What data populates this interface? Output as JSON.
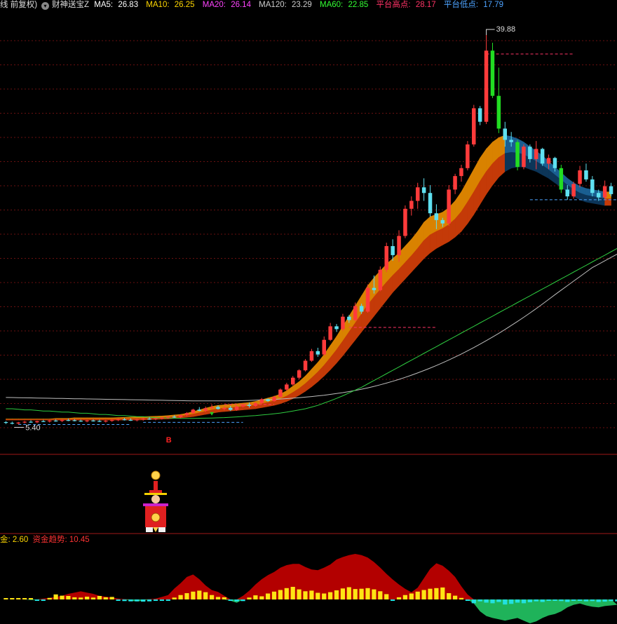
{
  "header": {
    "period_mode": "线 前复权)",
    "indicator_name": "财神送宝Z",
    "dropdown_icon": "chevron-down-icon",
    "ma5_label": "MA5:",
    "ma5_value": "26.83",
    "ma10_label": "MA10:",
    "ma10_value": "26.25",
    "ma20_label": "MA20:",
    "ma20_value": "26.14",
    "ma120_label": "MA120:",
    "ma120_value": "23.29",
    "ma60_label": "MA60:",
    "ma60_value": "22.85",
    "platform_high_label": "平台高点:",
    "platform_high_value": "28.17",
    "platform_low_label": "平台低点:",
    "platform_low_value": "17.79",
    "colors": {
      "ma5": "#ffffff",
      "ma10": "#ffd700",
      "ma20": "#ff44ff",
      "ma120": "#cccccc",
      "ma60": "#33ff33",
      "platform_high": "#ff3366",
      "platform_low": "#4da3ff"
    }
  },
  "sub_header": {
    "fund_label": "金:",
    "fund_value": "2.60",
    "trend_label": "资金趋势:",
    "trend_value": "10.45",
    "colors": {
      "fund": "#ffd700",
      "trend": "#ff3333"
    }
  },
  "chart_data": {
    "type": "candlestick",
    "y_range": [
      5.0,
      40.5
    ],
    "annotations": {
      "max_price": "39.88",
      "min_price": "5.40",
      "buy_marker": "B"
    },
    "candles": [
      [
        5.62,
        5.7,
        5.45,
        5.55
      ],
      [
        5.55,
        5.66,
        5.42,
        5.5
      ],
      [
        5.5,
        5.64,
        5.4,
        5.58
      ],
      [
        5.58,
        5.72,
        5.5,
        5.65
      ],
      [
        5.65,
        5.78,
        5.55,
        5.6
      ],
      [
        5.6,
        5.74,
        5.52,
        5.7
      ],
      [
        5.7,
        5.82,
        5.62,
        5.68
      ],
      [
        5.68,
        5.8,
        5.58,
        5.75
      ],
      [
        5.75,
        5.86,
        5.65,
        5.72
      ],
      [
        5.72,
        5.84,
        5.62,
        5.8
      ],
      [
        5.8,
        5.92,
        5.7,
        5.78
      ],
      [
        5.78,
        5.88,
        5.68,
        5.74
      ],
      [
        5.74,
        5.84,
        5.64,
        5.7
      ],
      [
        5.7,
        5.82,
        5.6,
        5.76
      ],
      [
        5.76,
        5.86,
        5.66,
        5.72
      ],
      [
        5.72,
        5.84,
        5.62,
        5.68
      ],
      [
        5.68,
        5.8,
        5.58,
        5.74
      ],
      [
        5.74,
        5.86,
        5.64,
        5.8
      ],
      [
        5.8,
        5.92,
        5.7,
        5.86
      ],
      [
        5.86,
        5.98,
        5.76,
        5.82
      ],
      [
        5.82,
        5.94,
        5.72,
        5.78
      ],
      [
        5.78,
        5.9,
        5.68,
        5.85
      ],
      [
        5.85,
        5.98,
        5.75,
        5.92
      ],
      [
        5.92,
        6.05,
        5.82,
        5.88
      ],
      [
        5.88,
        6.0,
        5.78,
        5.95
      ],
      [
        5.95,
        6.08,
        5.85,
        6.02
      ],
      [
        6.02,
        6.15,
        5.92,
        6.1
      ],
      [
        6.1,
        6.22,
        6.0,
        6.06
      ],
      [
        6.06,
        6.2,
        5.96,
        6.25
      ],
      [
        6.25,
        6.5,
        6.15,
        6.42
      ],
      [
        6.42,
        6.8,
        6.36,
        6.72
      ],
      [
        6.72,
        6.95,
        6.58,
        6.62
      ],
      [
        6.62,
        7.0,
        6.52,
        6.85
      ],
      [
        6.85,
        7.2,
        6.75,
        6.95
      ],
      [
        6.95,
        7.1,
        6.72,
        6.78
      ],
      [
        6.78,
        7.02,
        6.66,
        6.88
      ],
      [
        6.88,
        7.05,
        6.6,
        6.7
      ],
      [
        6.7,
        7.1,
        6.62,
        7.0
      ],
      [
        7.0,
        7.3,
        6.92,
        7.15
      ],
      [
        7.15,
        7.35,
        6.9,
        7.05
      ],
      [
        7.05,
        7.4,
        6.98,
        7.3
      ],
      [
        7.3,
        7.75,
        7.2,
        7.65
      ],
      [
        7.65,
        7.7,
        7.4,
        7.48
      ],
      [
        7.48,
        7.95,
        7.42,
        7.85
      ],
      [
        7.85,
        8.6,
        7.8,
        8.5
      ],
      [
        8.5,
        9.1,
        8.4,
        8.95
      ],
      [
        8.95,
        9.7,
        8.85,
        9.55
      ],
      [
        9.55,
        10.3,
        9.4,
        10.2
      ],
      [
        10.2,
        11.2,
        10.1,
        11.05
      ],
      [
        11.05,
        12.1,
        10.95,
        11.9
      ],
      [
        11.9,
        12.2,
        11.4,
        11.6
      ],
      [
        11.6,
        13.2,
        11.5,
        12.9
      ],
      [
        12.9,
        14.4,
        12.8,
        14.1
      ],
      [
        14.1,
        14.3,
        13.6,
        13.85
      ],
      [
        13.85,
        15.2,
        13.7,
        14.95
      ],
      [
        14.95,
        15.1,
        14.4,
        14.65
      ],
      [
        14.65,
        16.2,
        14.55,
        15.9
      ],
      [
        15.9,
        16.1,
        15.2,
        15.4
      ],
      [
        15.4,
        17.8,
        15.3,
        17.5
      ],
      [
        17.5,
        18.6,
        17.0,
        17.3
      ],
      [
        17.3,
        19.4,
        17.2,
        19.1
      ],
      [
        19.1,
        21.5,
        18.9,
        21.2
      ],
      [
        21.2,
        21.8,
        19.9,
        20.4
      ],
      [
        20.4,
        22.6,
        19.8,
        22.1
      ],
      [
        22.1,
        24.8,
        21.9,
        24.5
      ],
      [
        24.5,
        25.6,
        23.9,
        25.2
      ],
      [
        25.2,
        26.8,
        24.5,
        26.4
      ],
      [
        26.4,
        27.2,
        25.2,
        25.9
      ],
      [
        25.9,
        26.6,
        23.8,
        24.1
      ],
      [
        24.1,
        24.9,
        22.7,
        23.5
      ],
      [
        23.5,
        23.7,
        22.9,
        23.2
      ],
      [
        23.2,
        26.6,
        23.0,
        26.2
      ],
      [
        26.2,
        27.6,
        25.8,
        27.4
      ],
      [
        27.4,
        28.4,
        26.9,
        28.1
      ],
      [
        28.1,
        30.5,
        27.9,
        30.2
      ],
      [
        30.2,
        33.7,
        30.0,
        33.4
      ],
      [
        33.4,
        33.6,
        31.9,
        32.2
      ],
      [
        32.2,
        39.88,
        32.0,
        38.5
      ],
      [
        38.5,
        39.2,
        34.3,
        34.5
      ],
      [
        34.5,
        37.0,
        31.2,
        31.6
      ],
      [
        31.6,
        32.2,
        30.0,
        30.6
      ],
      [
        30.6,
        31.3,
        30.0,
        30.4
      ],
      [
        30.4,
        30.6,
        27.9,
        28.2
      ],
      [
        28.2,
        30.2,
        28.0,
        30.0
      ],
      [
        30.0,
        30.2,
        28.6,
        28.9
      ],
      [
        28.9,
        30.5,
        28.0,
        29.8
      ],
      [
        29.8,
        29.9,
        28.3,
        28.5
      ],
      [
        28.5,
        29.3,
        28.0,
        29.0
      ],
      [
        29.0,
        29.1,
        27.8,
        28.1
      ],
      [
        28.1,
        28.4,
        25.9,
        26.2
      ],
      [
        26.2,
        26.6,
        25.3,
        25.6
      ],
      [
        25.6,
        26.9,
        25.4,
        26.7
      ],
      [
        26.7,
        28.3,
        26.4,
        27.9
      ],
      [
        27.9,
        28.5,
        26.9,
        27.1
      ],
      [
        27.1,
        27.4,
        25.6,
        25.9
      ],
      [
        25.9,
        26.2,
        25.2,
        25.5
      ],
      [
        25.5,
        27.0,
        25.3,
        26.5
      ],
      [
        26.5,
        26.8,
        25.6,
        25.8
      ]
    ],
    "ma60": [
      6.8,
      6.8,
      6.75,
      6.7,
      6.7,
      6.65,
      6.6,
      6.6,
      6.55,
      6.5,
      6.5,
      6.45,
      6.4,
      6.4,
      6.35,
      6.3,
      6.3,
      6.25,
      6.2,
      6.2,
      6.15,
      6.1,
      6.1,
      6.05,
      6.0,
      6.0,
      5.98,
      5.96,
      5.95,
      5.95,
      5.95,
      5.96,
      5.97,
      5.98,
      6.0,
      6.02,
      6.05,
      6.08,
      6.12,
      6.16,
      6.2,
      6.25,
      6.3,
      6.36,
      6.42,
      6.5,
      6.6,
      6.7,
      6.8,
      6.95,
      7.1,
      7.3,
      7.5,
      7.72,
      7.95,
      8.2,
      8.45,
      8.7,
      9.0,
      9.3,
      9.6,
      9.9,
      10.2,
      10.5,
      10.8,
      11.1,
      11.4,
      11.7,
      12.0,
      12.3,
      12.6,
      12.9,
      13.2,
      13.5,
      13.8,
      14.1,
      14.4,
      14.7,
      15.0,
      15.3,
      15.6,
      15.9,
      16.2,
      16.5,
      16.8,
      17.1,
      17.4,
      17.7,
      18.0,
      18.3,
      18.6,
      18.9,
      19.2,
      19.5,
      19.8,
      20.1,
      20.4,
      20.7,
      21.0
    ],
    "ma120": [
      7.8,
      7.79,
      7.78,
      7.77,
      7.76,
      7.75,
      7.74,
      7.73,
      7.72,
      7.71,
      7.7,
      7.69,
      7.68,
      7.67,
      7.66,
      7.65,
      7.64,
      7.63,
      7.62,
      7.61,
      7.6,
      7.59,
      7.58,
      7.57,
      7.56,
      7.55,
      7.54,
      7.53,
      7.52,
      7.51,
      7.5,
      7.5,
      7.5,
      7.5,
      7.5,
      7.5,
      7.5,
      7.5,
      7.52,
      7.54,
      7.56,
      7.58,
      7.6,
      7.63,
      7.66,
      7.7,
      7.74,
      7.78,
      7.83,
      7.88,
      7.94,
      8.0,
      8.07,
      8.15,
      8.23,
      8.32,
      8.42,
      8.53,
      8.65,
      8.78,
      8.92,
      9.07,
      9.23,
      9.4,
      9.58,
      9.77,
      9.97,
      10.18,
      10.4,
      10.63,
      10.87,
      11.12,
      11.38,
      11.65,
      11.93,
      12.22,
      12.52,
      12.83,
      13.15,
      13.48,
      13.82,
      14.17,
      14.53,
      14.9,
      15.28,
      15.67,
      16.07,
      16.48,
      16.9,
      17.3,
      17.7,
      18.1,
      18.5,
      18.9,
      19.3,
      19.6,
      19.9,
      20.2,
      20.5
    ],
    "ribbon_upper": [
      5.9,
      5.9,
      5.9,
      5.9,
      5.9,
      5.9,
      5.9,
      5.9,
      5.95,
      5.95,
      5.95,
      6.0,
      6.0,
      6.0,
      6.0,
      6.0,
      6.0,
      6.0,
      6.02,
      6.04,
      6.06,
      6.08,
      6.1,
      6.12,
      6.14,
      6.16,
      6.2,
      6.25,
      6.3,
      6.4,
      6.55,
      6.7,
      6.85,
      7.0,
      7.1,
      7.15,
      7.2,
      7.25,
      7.3,
      7.35,
      7.45,
      7.6,
      7.75,
      7.9,
      8.1,
      8.4,
      8.8,
      9.2,
      9.7,
      10.3,
      10.9,
      11.6,
      12.4,
      13.2,
      14.1,
      15.0,
      15.9,
      16.8,
      17.7,
      18.4,
      19.0,
      19.6,
      20.1,
      20.6,
      21.2,
      21.8,
      22.5,
      23.3,
      23.8,
      24.0,
      24.2,
      24.6,
      25.2,
      26.0,
      27.0,
      28.0,
      29.0,
      29.8,
      30.4,
      30.8,
      31.0,
      30.9,
      30.7,
      30.4,
      30.0,
      29.6,
      29.2,
      28.7,
      28.2,
      27.7,
      27.2,
      26.8,
      26.5,
      26.3,
      26.2,
      26.1,
      26.0,
      26.0,
      26.0
    ],
    "ribbon_lower": [
      5.8,
      5.8,
      5.8,
      5.8,
      5.8,
      5.8,
      5.8,
      5.8,
      5.8,
      5.8,
      5.8,
      5.8,
      5.8,
      5.8,
      5.8,
      5.8,
      5.8,
      5.8,
      5.8,
      5.8,
      5.8,
      5.8,
      5.82,
      5.84,
      5.86,
      5.88,
      5.9,
      5.95,
      6.0,
      6.05,
      6.1,
      6.2,
      6.3,
      6.4,
      6.5,
      6.55,
      6.6,
      6.65,
      6.7,
      6.75,
      6.8,
      6.9,
      7.0,
      7.1,
      7.25,
      7.45,
      7.7,
      8.0,
      8.35,
      8.75,
      9.2,
      9.7,
      10.25,
      10.85,
      11.5,
      12.2,
      12.9,
      13.6,
      14.3,
      15.0,
      15.7,
      16.4,
      17.1,
      17.7,
      18.3,
      18.9,
      19.5,
      20.1,
      20.6,
      21.0,
      21.3,
      21.6,
      22.0,
      22.5,
      23.2,
      24.0,
      24.9,
      25.8,
      26.6,
      27.3,
      27.8,
      28.1,
      28.2,
      28.2,
      28.0,
      27.8,
      27.5,
      27.2,
      26.8,
      26.4,
      26.0,
      25.6,
      25.3,
      25.1,
      25.0,
      24.9,
      24.8,
      24.8,
      24.8
    ],
    "platform_highs": [
      {
        "value": 38.2,
        "from": 77,
        "to": 91
      },
      {
        "value": 14.0,
        "from": 55,
        "to": 69
      },
      {
        "value": 7.18,
        "from": 35,
        "to": 43
      }
    ],
    "platform_lows": [
      {
        "value": 25.3,
        "from": 84,
        "to": 98
      },
      {
        "value": 5.4,
        "from": 2,
        "to": 20
      },
      {
        "value": 5.6,
        "from": 22,
        "to": 38
      }
    ],
    "buy_index": 33,
    "money_flow": [
      0,
      0,
      0.1,
      0.1,
      -0.1,
      -0.1,
      0.3,
      0.5,
      0.8,
      1.2,
      1.8,
      2.2,
      2.6,
      2.2,
      1.8,
      1.2,
      0.9,
      0.6,
      0.3,
      0.1,
      -0.2,
      -0.3,
      -0.2,
      0.1,
      0.3,
      0.8,
      1.4,
      3.5,
      5.2,
      7.2,
      8.0,
      6.5,
      4.5,
      3.0,
      2.4,
      1.2,
      -0.2,
      -0.5,
      1.2,
      2.8,
      4.8,
      6.5,
      7.8,
      8.8,
      10.2,
      11.0,
      11.4,
      11.4,
      10.4,
      9.6,
      9.4,
      10.2,
      11.2,
      12.8,
      13.6,
      14.2,
      14.6,
      14.2,
      13.4,
      12.0,
      10.2,
      8.2,
      6.4,
      4.8,
      3.4,
      2.3,
      3.8,
      6.8,
      9.8,
      11.6,
      10.8,
      9.2,
      7.2,
      4.2,
      1.6,
      -0.6,
      -1.8,
      -2.5,
      -2.8,
      -3.0,
      -3.2,
      -3.0,
      -2.8,
      -3.2,
      -3.6,
      -3.3,
      -2.8,
      -2.4,
      -2.2,
      -1.8,
      -1.2,
      -0.8,
      -0.6,
      -0.9,
      -1.1,
      -1.2,
      -1.0,
      -0.9,
      -0.8
    ],
    "money_bars": [
      0.3,
      0.2,
      0.4,
      0.2,
      0.1,
      -0.3,
      -0.1,
      0.5,
      1.6,
      1.2,
      1.1,
      0.7,
      0.6,
      0.9,
      0.6,
      1.1,
      0.7,
      0.8,
      -0.3,
      -0.5,
      -0.6,
      -0.6,
      -0.7,
      -0.6,
      -0.4,
      -0.3,
      -0.2,
      0.6,
      1.4,
      2.0,
      2.5,
      2.8,
      2.3,
      1.4,
      0.8,
      0.7,
      -0.3,
      -0.6,
      -0.5,
      0.6,
      1.3,
      1.0,
      1.9,
      2.5,
      3.0,
      3.6,
      4.0,
      3.2,
      2.6,
      2.8,
      2.1,
      1.9,
      2.3,
      2.9,
      3.5,
      3.9,
      3.3,
      3.4,
      3.6,
      3.2,
      2.6,
      1.7,
      -0.4,
      0.7,
      1.4,
      1.9,
      2.5,
      3.0,
      3.4,
      3.6,
      3.8,
      2.0,
      1.2,
      0.5,
      -0.3,
      -1.2,
      -0.6,
      -1.0,
      -1.2,
      -0.8,
      -1.6,
      -1.4,
      -1.0,
      -1.2,
      -0.9,
      -0.6,
      -0.8,
      -0.4,
      -0.2,
      -0.5,
      -0.8,
      -0.3,
      -0.4,
      -0.6,
      -0.5,
      -0.8,
      -0.7,
      -0.5,
      -0.6
    ]
  }
}
